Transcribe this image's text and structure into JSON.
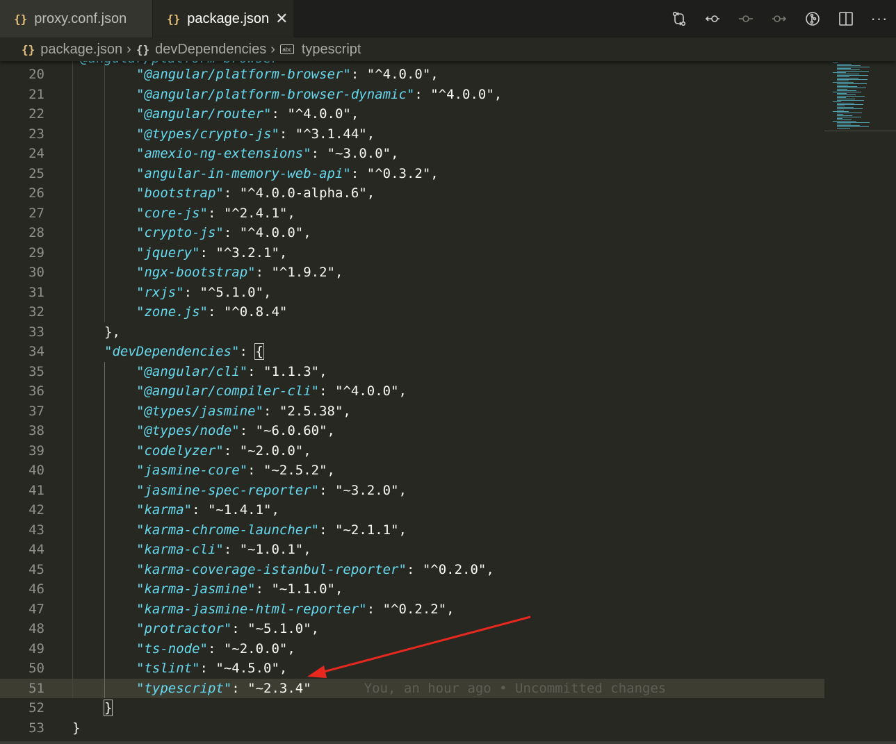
{
  "tabs": [
    {
      "label": "proxy.conf.json",
      "icon": "json-braces-icon",
      "active": false
    },
    {
      "label": "package.json",
      "icon": "json-braces-icon",
      "active": true,
      "close": "✕"
    }
  ],
  "breadcrumb": {
    "file": "package.json",
    "section": "devDependencies",
    "item": "typescript",
    "abc": "abc"
  },
  "top_partial_line": "\"@angular/platform-browser\"",
  "editor_lines": [
    {
      "n": "20",
      "key": "\"@angular/platform-browser\"",
      "val": "\"^4.0.0\","
    },
    {
      "n": "21",
      "key": "\"@angular/platform-browser-dynamic\"",
      "val": "\"^4.0.0\","
    },
    {
      "n": "22",
      "key": "\"@angular/router\"",
      "val": "\"^4.0.0\","
    },
    {
      "n": "23",
      "key": "\"@types/crypto-js\"",
      "val": "\"^3.1.44\","
    },
    {
      "n": "24",
      "key": "\"amexio-ng-extensions\"",
      "val": "\"~3.0.0\","
    },
    {
      "n": "25",
      "key": "\"angular-in-memory-web-api\"",
      "val": "\"^0.3.2\","
    },
    {
      "n": "26",
      "key": "\"bootstrap\"",
      "val": "\"^4.0.0-alpha.6\","
    },
    {
      "n": "27",
      "key": "\"core-js\"",
      "val": "\"^2.4.1\","
    },
    {
      "n": "28",
      "key": "\"crypto-js\"",
      "val": "\"^4.0.0\","
    },
    {
      "n": "29",
      "key": "\"jquery\"",
      "val": "\"^3.2.1\","
    },
    {
      "n": "30",
      "key": "\"ngx-bootstrap\"",
      "val": "\"^1.9.2\","
    },
    {
      "n": "31",
      "key": "\"rxjs\"",
      "val": "\"^5.1.0\","
    },
    {
      "n": "32",
      "key": "\"zone.js\"",
      "val": "\"^0.8.4\""
    },
    {
      "n": "33",
      "plain": "},"
    },
    {
      "n": "34",
      "key": "\"devDependencies\"",
      "bracket": "{"
    },
    {
      "n": "35",
      "key": "\"@angular/cli\"",
      "val": "\"1.1.3\","
    },
    {
      "n": "36",
      "key": "\"@angular/compiler-cli\"",
      "val": "\"^4.0.0\","
    },
    {
      "n": "37",
      "key": "\"@types/jasmine\"",
      "val": "\"2.5.38\","
    },
    {
      "n": "38",
      "key": "\"@types/node\"",
      "val": "\"~6.0.60\","
    },
    {
      "n": "39",
      "key": "\"codelyzer\"",
      "val": "\"~2.0.0\","
    },
    {
      "n": "40",
      "key": "\"jasmine-core\"",
      "val": "\"~2.5.2\","
    },
    {
      "n": "41",
      "key": "\"jasmine-spec-reporter\"",
      "val": "\"~3.2.0\","
    },
    {
      "n": "42",
      "key": "\"karma\"",
      "val": "\"~1.4.1\","
    },
    {
      "n": "43",
      "key": "\"karma-chrome-launcher\"",
      "val": "\"~2.1.1\","
    },
    {
      "n": "44",
      "key": "\"karma-cli\"",
      "val": "\"~1.0.1\","
    },
    {
      "n": "45",
      "key": "\"karma-coverage-istanbul-reporter\"",
      "val": "\"^0.2.0\","
    },
    {
      "n": "46",
      "key": "\"karma-jasmine\"",
      "val": "\"~1.1.0\","
    },
    {
      "n": "47",
      "key": "\"karma-jasmine-html-reporter\"",
      "val": "\"^0.2.2\","
    },
    {
      "n": "48",
      "key": "\"protractor\"",
      "val": "\"~5.1.0\","
    },
    {
      "n": "49",
      "key": "\"ts-node\"",
      "val": "\"~2.0.0\","
    },
    {
      "n": "50",
      "key": "\"tslint\"",
      "val": "\"~4.5.0\","
    },
    {
      "n": "51",
      "key": "\"typescript\"",
      "val": "\"~2.3.4\"",
      "blame": "You, an hour ago • Uncommitted changes",
      "current": true
    },
    {
      "n": "52",
      "plain": "}",
      "bracket_hl": true
    },
    {
      "n": "53",
      "plain": "}"
    }
  ],
  "toolbar_actions": [
    {
      "name": "compare-changes-icon"
    },
    {
      "name": "previous-change-icon"
    },
    {
      "name": "git-commit-icon"
    },
    {
      "name": "next-change-icon"
    },
    {
      "name": "git-lens-icon"
    },
    {
      "name": "split-editor-icon"
    },
    {
      "name": "more-actions-icon",
      "label": "···"
    }
  ],
  "colors": {
    "background": "#272822",
    "key": "#66d9ef",
    "string": "#f8f8f2",
    "line_number": "#90908a",
    "annotation_arrow": "#e8281f"
  }
}
